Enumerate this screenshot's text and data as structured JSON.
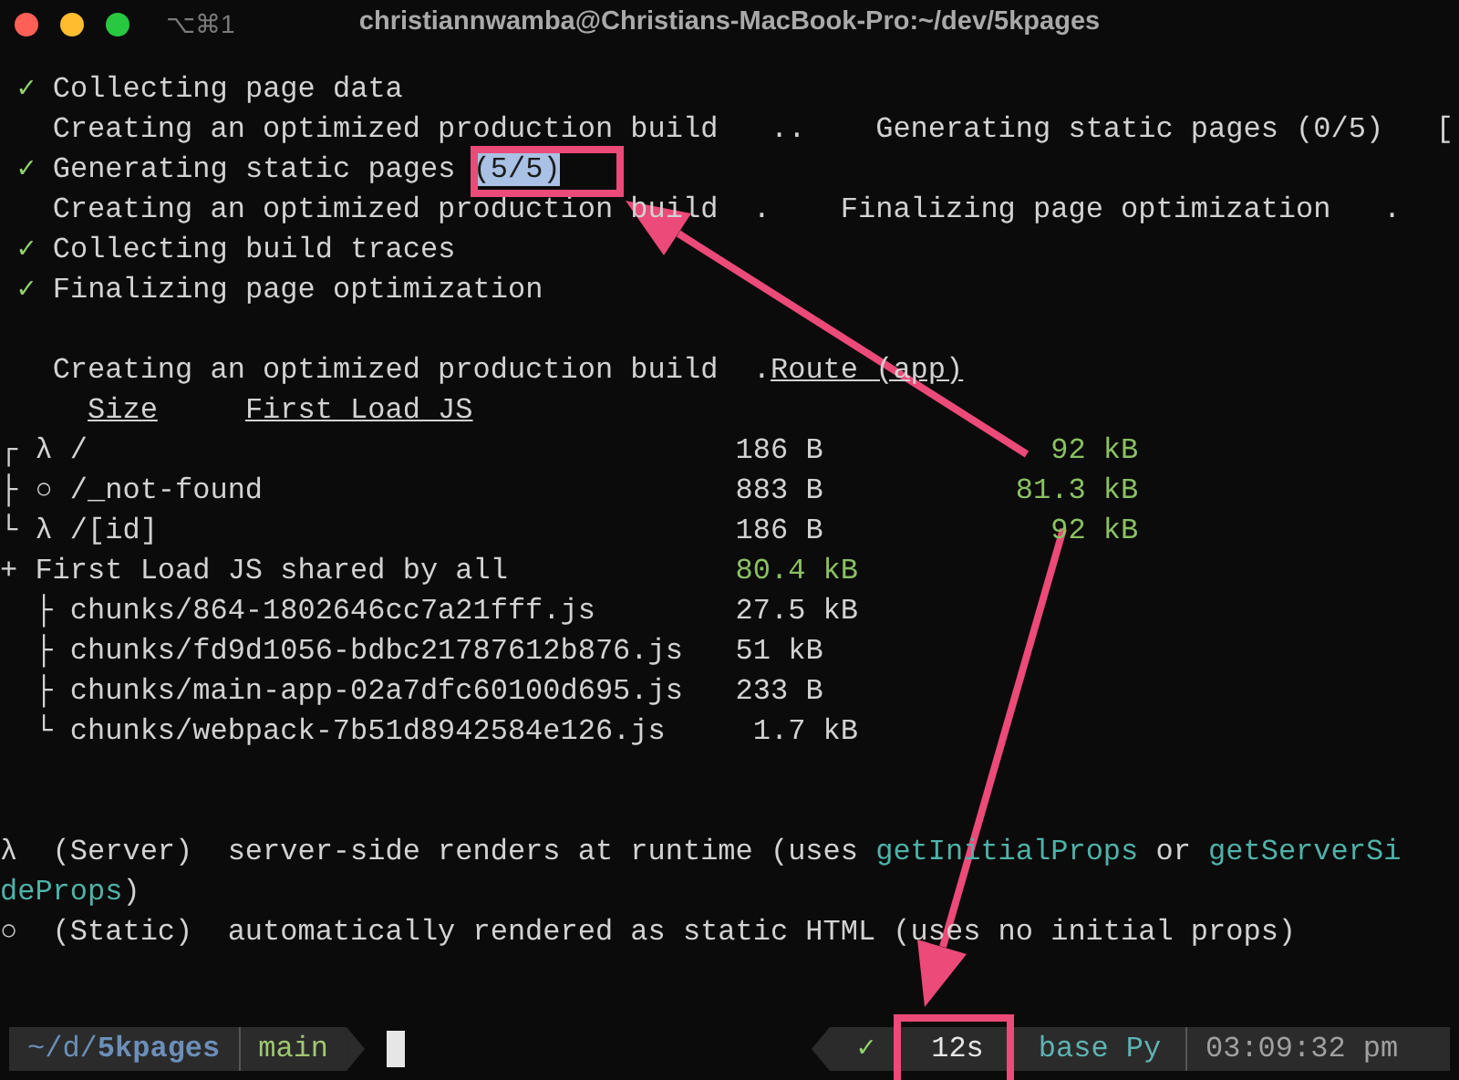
{
  "window": {
    "title": "christiannwamba@Christians-MacBook-Pro:~/dev/5kpages",
    "shortcut": "⌥⌘1"
  },
  "blocks": [
    [
      [
        {
          "text": " ✓",
          "kind": "ok"
        },
        {
          "text": " Collecting page data",
          "kind": "plain"
        }
      ],
      [
        {
          "text": "   Creating an optimized production build",
          "kind": "plain"
        },
        {
          "text": "   ..",
          "kind": "plain"
        },
        {
          "text": "    Generating static pages (0/5)",
          "kind": "plain"
        },
        {
          "text": "   [",
          "kind": "plain"
        }
      ],
      [
        {
          "text": " ✓",
          "kind": "ok"
        },
        {
          "text": " Generating static pages",
          "kind": "plain"
        },
        {
          "text": " (5/5)",
          "kind": "selected"
        }
      ],
      [
        {
          "text": "   Creating an optimized production build",
          "kind": "plain"
        },
        {
          "text": "  .",
          "kind": "plain"
        },
        {
          "text": "    Finalizing page optimization",
          "kind": "plain"
        },
        {
          "text": "   .",
          "kind": "plain"
        }
      ],
      [
        {
          "text": " ✓",
          "kind": "ok"
        },
        {
          "text": " Collecting build traces",
          "kind": "plain"
        }
      ],
      [
        {
          "text": " ✓",
          "kind": "ok"
        },
        {
          "text": " Finalizing page optimization",
          "kind": "plain"
        }
      ]
    ],
    [
      [
        {
          "text": "   Creating an optimized production build",
          "kind": "plain"
        },
        {
          "text": "  .",
          "kind": "plain"
        },
        {
          "text": "Route (app)",
          "kind": "heading"
        }
      ],
      [
        {
          "text": "     Size",
          "kind": "heading"
        },
        {
          "text": "     First Load JS",
          "kind": "heading"
        }
      ],
      [
        {
          "text": "┌ λ /",
          "kind": "plain"
        },
        {
          "text": "                                     186 B",
          "kind": "plain"
        },
        {
          "text": "             92 kB",
          "kind": "size"
        }
      ],
      [
        {
          "text": "├ ○ /_not-found",
          "kind": "plain"
        },
        {
          "text": "                           883 B",
          "kind": "plain"
        },
        {
          "text": "           81.3 kB",
          "kind": "size"
        }
      ],
      [
        {
          "text": "└ λ /[id]",
          "kind": "plain"
        },
        {
          "text": "                                 186 B",
          "kind": "plain"
        },
        {
          "text": "             92 kB",
          "kind": "size"
        }
      ],
      [
        {
          "text": "+ First Load JS shared by all",
          "kind": "plain"
        },
        {
          "text": "             80.4 kB",
          "kind": "size"
        }
      ],
      [
        {
          "text": "  ├ chunks/864-1802646cc7a21fff.js",
          "kind": "plain"
        },
        {
          "text": "        27.5 kB",
          "kind": "plain"
        }
      ],
      [
        {
          "text": "  ├ chunks/fd9d1056-bdbc21787612b876.js",
          "kind": "plain"
        },
        {
          "text": "   51 kB",
          "kind": "plain"
        }
      ],
      [
        {
          "text": "  ├ chunks/main-app-02a7dfc60100d695.js",
          "kind": "plain"
        },
        {
          "text": "   233 B",
          "kind": "plain"
        }
      ],
      [
        {
          "text": "  └ chunks/webpack-7b51d8942584e126.js",
          "kind": "plain"
        },
        {
          "text": "     1.7 kB",
          "kind": "plain"
        }
      ]
    ],
    [
      [
        {
          "text": "λ  (Server)  server-side renders at runtime (uses",
          "kind": "plain"
        },
        {
          "text": " getInitialProps",
          "kind": "code"
        },
        {
          "text": " or",
          "kind": "plain"
        },
        {
          "text": " getServerSi",
          "kind": "code"
        }
      ],
      [
        {
          "text": "deProps",
          "kind": "code"
        },
        {
          "text": ")",
          "kind": "plain"
        }
      ],
      [
        {
          "text": "○  (Static)  automatically rendered as static HTML (uses no initial props)",
          "kind": "plain"
        }
      ]
    ]
  ],
  "prompt": {
    "path": "~/d/**5kpages**",
    "branch": "main"
  },
  "status": {
    "check": "✓",
    "duration": "12s",
    "env": "base Py",
    "time": "03:09:32 pm"
  }
}
